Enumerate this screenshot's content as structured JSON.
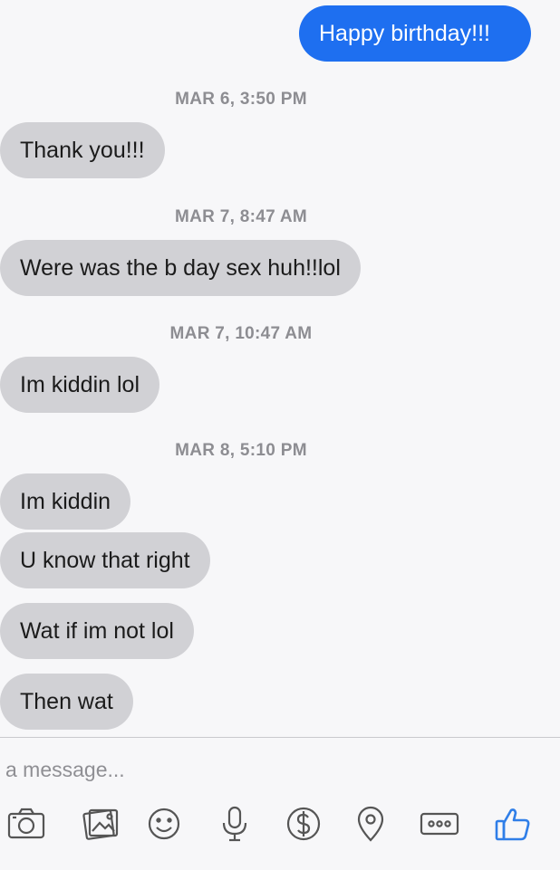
{
  "messages": {
    "m1": "Happy birthday!!!",
    "m2": "Thank you!!!",
    "m3": "Were was the b day sex huh!!lol",
    "m4": "Im kiddin lol",
    "m5": "Im kiddin",
    "m6": "U know that right",
    "m7": "Wat if im not lol",
    "m8": "Then wat"
  },
  "timestamps": {
    "t1": "MAR 6, 3:50 PM",
    "t2": "MAR 7, 8:47 AM",
    "t3": "MAR 7, 10:47 AM",
    "t4": "MAR 8, 5:10 PM"
  },
  "composer": {
    "placeholder": "a message..."
  },
  "toolbar": {
    "icons": [
      "camera-icon",
      "photo-gallery-icon",
      "emoji-icon",
      "microphone-icon",
      "payment-icon",
      "location-icon",
      "more-icon",
      "like-icon"
    ]
  },
  "colors": {
    "outgoing_bubble": "#1e6ff0",
    "incoming_bubble": "#d1d1d5",
    "accent_icon": "#2f7ee8",
    "timestamp_text": "#8d8d92"
  }
}
